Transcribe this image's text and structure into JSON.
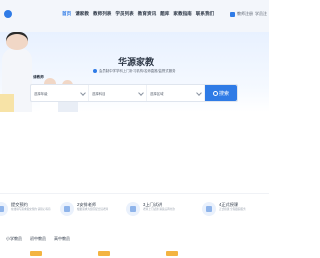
{
  "nav": {
    "items": [
      {
        "label": "首页"
      },
      {
        "label": "请家教"
      },
      {
        "label": "教师列表"
      },
      {
        "label": "学员列表"
      },
      {
        "label": "教育资讯"
      },
      {
        "label": "题库"
      },
      {
        "label": "家教指南"
      },
      {
        "label": "联系我们"
      }
    ],
    "active_index": 0,
    "right": {
      "label": "教师注册",
      "extra": "学员注"
    }
  },
  "hero": {
    "brand": "华源家教",
    "subtitle": "会员制中学学科上门补习机构/名师直推/监督式服务",
    "caption": "请教师"
  },
  "search": {
    "select1": "选择年级",
    "select2": "选择科目",
    "select3": "选择区域",
    "button": "搜索"
  },
  "steps": [
    {
      "title": "提交预约",
      "desc": "在线填写需求提交预约 请耐心等待"
    },
    {
      "title": "2安排老师",
      "desc": "根据需求为您匹配合适老师"
    },
    {
      "title": "3上门试讲",
      "desc": "老师上门试讲 满意后再付款"
    },
    {
      "title": "4正式授课",
      "desc": "正式授课 全程跟踪服务"
    }
  ],
  "tabs": [
    {
      "label": "小学教员"
    },
    {
      "label": "初中教员"
    },
    {
      "label": "高中教员"
    }
  ],
  "colors": {
    "accent": "#2f7be6",
    "badge": "#f3b441"
  }
}
